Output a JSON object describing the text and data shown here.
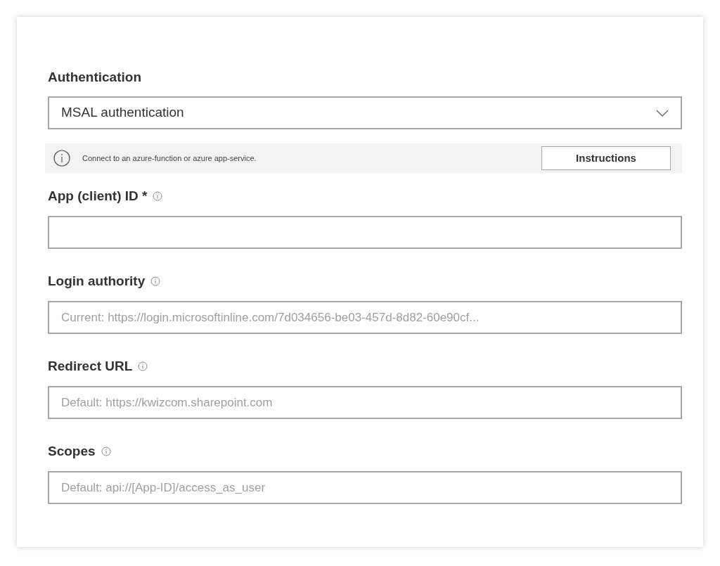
{
  "authentication": {
    "label": "Authentication",
    "dropdown": {
      "value": "MSAL authentication"
    }
  },
  "info_bar": {
    "message": "Connect to an azure-function or azure app-service.",
    "button": "Instructions"
  },
  "fields": [
    {
      "label": "App (client) ID *"
    },
    {
      "label": "Login authority",
      "placeholder": "Current: https://login.microsoftinline.com/7d034656-be03-457d-8d82-60e90cf..."
    },
    {
      "label": "Redirect URL",
      "placeholder": "Default: https://kwizcom.sharepoint.com"
    },
    {
      "label": "Scopes",
      "placeholder": "Default: api://[App-ID]/access_as_user"
    }
  ]
}
